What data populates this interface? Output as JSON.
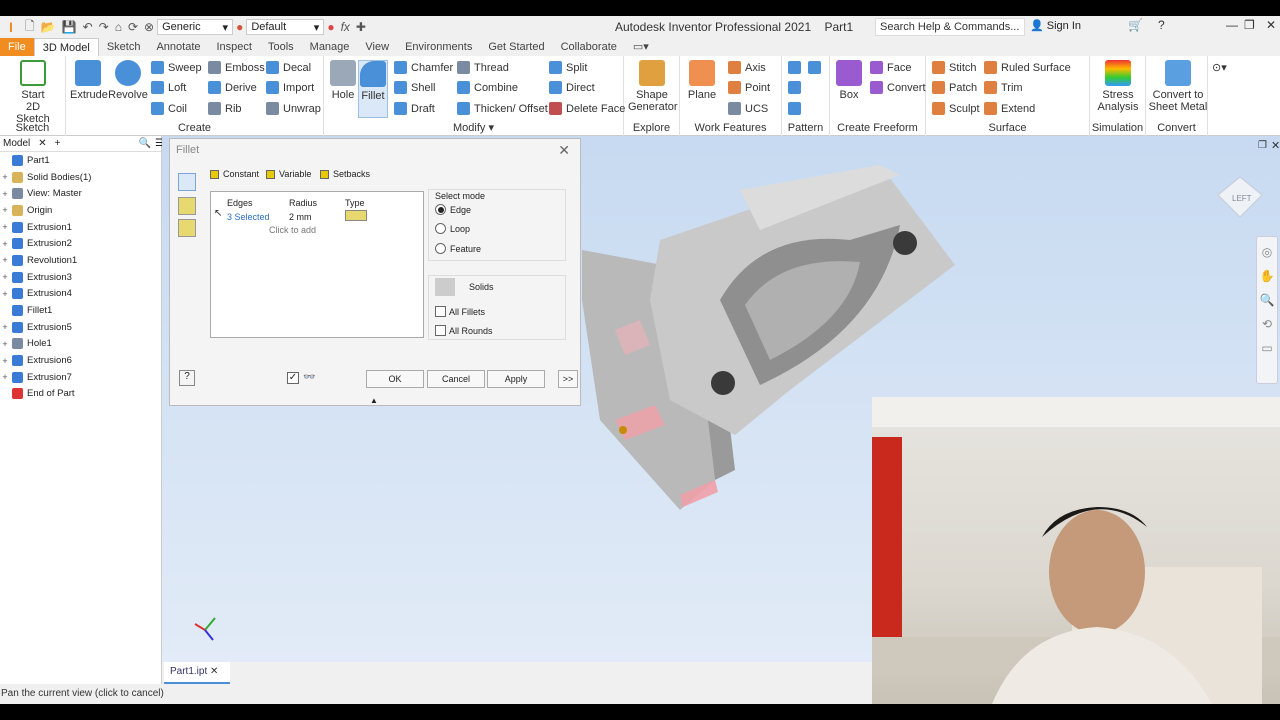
{
  "app": {
    "title": "Autodesk Inventor Professional 2021",
    "document": "Part1",
    "appearance_preset": "Generic",
    "material_preset": "Default",
    "help_search_placeholder": "Search Help & Commands...",
    "sign_in": "Sign In"
  },
  "menu_tabs": [
    "File",
    "3D Model",
    "Sketch",
    "Annotate",
    "Inspect",
    "Tools",
    "Manage",
    "View",
    "Environments",
    "Get Started",
    "Collaborate"
  ],
  "ribbon": {
    "sketch": {
      "label": "Sketch",
      "start": "Start",
      "start2": "2D Sketch"
    },
    "create": {
      "label": "Create",
      "extrude": "Extrude",
      "revolve": "Revolve",
      "sweep": "Sweep",
      "loft": "Loft",
      "coil": "Coil",
      "emboss": "Emboss",
      "derive": "Derive",
      "rib": "Rib",
      "decal": "Decal",
      "import": "Import",
      "unwrap": "Unwrap"
    },
    "modify": {
      "label": "Modify",
      "hole": "Hole",
      "fillet": "Fillet",
      "chamfer": "Chamfer",
      "shell": "Shell",
      "draft": "Draft",
      "thread": "Thread",
      "combine": "Combine",
      "thicken": "Thicken/ Offset",
      "split": "Split",
      "direct": "Direct",
      "delete_face": "Delete Face"
    },
    "explore": {
      "label": "Explore",
      "shape": "Shape",
      "shape2": "Generator"
    },
    "work": {
      "label": "Work Features",
      "plane": "Plane",
      "axis": "Axis",
      "point": "Point",
      "ucs": "UCS"
    },
    "pattern": {
      "label": "Pattern"
    },
    "freeform": {
      "label": "Create Freeform",
      "box": "Box",
      "face": "Face",
      "convert": "Convert"
    },
    "surface": {
      "label": "Surface",
      "stitch": "Stitch",
      "patch": "Patch",
      "sculpt": "Sculpt",
      "ruled": "Ruled Surface",
      "trim": "Trim",
      "extend": "Extend"
    },
    "simulation": {
      "label": "Simulation",
      "stress": "Stress",
      "stress2": "Analysis"
    },
    "convert": {
      "label": "Convert",
      "sheet": "Convert to",
      "sheet2": "Sheet Metal"
    }
  },
  "browser": {
    "tab": "Model",
    "items": [
      {
        "label": "Part1",
        "expand": "",
        "color": "#3a7bd5"
      },
      {
        "label": "Solid Bodies(1)",
        "expand": "+",
        "color": "#d7b45a"
      },
      {
        "label": "View: Master",
        "expand": "+",
        "color": "#7a8aa0"
      },
      {
        "label": "Origin",
        "expand": "+",
        "color": "#d7b45a"
      },
      {
        "label": "Extrusion1",
        "expand": "+",
        "color": "#3a7bd5"
      },
      {
        "label": "Extrusion2",
        "expand": "+",
        "color": "#3a7bd5"
      },
      {
        "label": "Revolution1",
        "expand": "+",
        "color": "#3a7bd5"
      },
      {
        "label": "Extrusion3",
        "expand": "+",
        "color": "#3a7bd5"
      },
      {
        "label": "Extrusion4",
        "expand": "+",
        "color": "#3a7bd5"
      },
      {
        "label": "Fillet1",
        "expand": "",
        "color": "#3a7bd5"
      },
      {
        "label": "Extrusion5",
        "expand": "+",
        "color": "#3a7bd5"
      },
      {
        "label": "Hole1",
        "expand": "+",
        "color": "#7a8aa0"
      },
      {
        "label": "Extrusion6",
        "expand": "+",
        "color": "#3a7bd5"
      },
      {
        "label": "Extrusion7",
        "expand": "+",
        "color": "#3a7bd5"
      },
      {
        "label": "End of Part",
        "expand": "",
        "color": "#d33"
      }
    ]
  },
  "fillet_dialog": {
    "title": "Fillet",
    "tabs": [
      "Constant",
      "Variable",
      "Setbacks"
    ],
    "columns": [
      "Edges",
      "Radius",
      "Type"
    ],
    "row": {
      "edges": "3 Selected",
      "radius": "2 mm"
    },
    "click_to_add": "Click to add",
    "select_mode_label": "Select mode",
    "modes": [
      "Edge",
      "Loop",
      "Feature"
    ],
    "selected_mode": "Edge",
    "solids_label": "Solids",
    "all_fillets": "All Fillets",
    "all_rounds": "All Rounds",
    "ok": "OK",
    "cancel": "Cancel",
    "apply": "Apply",
    "more": ">>"
  },
  "document_tab": "Part1.ipt",
  "status_text": "Pan the current view (click to cancel)",
  "viewcube_label": "LEFT"
}
